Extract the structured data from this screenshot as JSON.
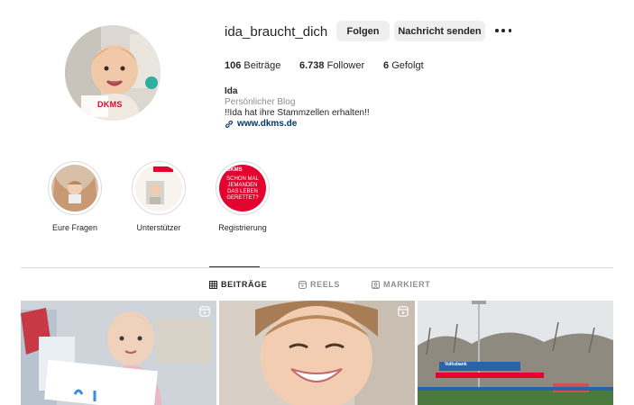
{
  "profile": {
    "username": "ida_braucht_dich",
    "follow_label": "Folgen",
    "message_label": "Nachricht senden",
    "avatar_badge": "DKMS",
    "stats": {
      "posts_count": "106",
      "posts_label": "Beiträge",
      "followers_count": "6.738",
      "followers_label": "Follower",
      "following_count": "6",
      "following_label": "Gefolgt"
    },
    "bio": {
      "name": "Ida",
      "category": "Persönlicher Blog",
      "text": "!!Ida hat ihre Stammzellen erhalten!!",
      "link": "www.dkms.de"
    }
  },
  "highlights": [
    {
      "label": "Eure Fragen"
    },
    {
      "label": "Unterstützer"
    },
    {
      "label": "Registrierung",
      "cover_text": "SCHON MAL JEMANDEN DAS LEBEN GERETTET?",
      "cover_brand": "DKMS"
    }
  ],
  "tabs": [
    {
      "label": "BEITRÄGE",
      "active": true,
      "icon": "grid-icon"
    },
    {
      "label": "REELS",
      "active": false,
      "icon": "reels-icon"
    },
    {
      "label": "MARKIERT",
      "active": false,
      "icon": "tagged-icon"
    }
  ],
  "posts": [
    {
      "kind": "photo",
      "badge": "reel-icon"
    },
    {
      "kind": "photo",
      "badge": "reel-icon"
    },
    {
      "kind": "photo",
      "banner_text": "Volksbank"
    }
  ],
  "colors": {
    "link": "#00376b",
    "button_bg": "#efefef",
    "dkms_red": "#e4032e",
    "muted": "#8e8e8e"
  }
}
